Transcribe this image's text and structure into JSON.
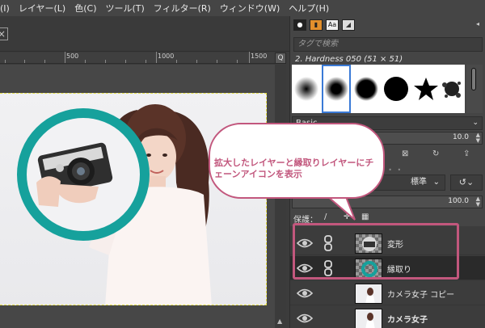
{
  "menu": {
    "items": [
      "(I)",
      "レイヤー(L)",
      "色(C)",
      "ツール(T)",
      "フィルター(R)",
      "ウィンドウ(W)",
      "ヘルプ(H)"
    ]
  },
  "canvas": {
    "ruler_labels": [
      "500",
      "1000",
      "1500"
    ],
    "nav_glyph": "Q"
  },
  "brushes": {
    "filter_placeholder": "タグで検索",
    "selected_brush": "2. Hardness 050 (51 × 51)",
    "tag": "Basic,",
    "spacing_label": "間隔",
    "spacing_value": "10.0"
  },
  "layers_panel": {
    "mode": "標準",
    "opacity_value": "100.0",
    "lock_label": "保護：",
    "layers": [
      {
        "name": "変形",
        "selected": false,
        "bold": false,
        "thumb": "checker-photo"
      },
      {
        "name": "縁取り",
        "selected": true,
        "bold": false,
        "thumb": "checker-teal"
      },
      {
        "name": "カメラ女子 コピー",
        "selected": false,
        "bold": false,
        "thumb": "photo"
      },
      {
        "name": "カメラ女子",
        "selected": false,
        "bold": true,
        "thumb": "photo"
      }
    ]
  },
  "annotation": {
    "text": "拡大したレイヤーと縁取りレイヤーにチェーンアイコンを表示",
    "color": "#c2577d"
  },
  "colors": {
    "teal_ring": "#16a19c",
    "highlight": "#c2577d"
  }
}
